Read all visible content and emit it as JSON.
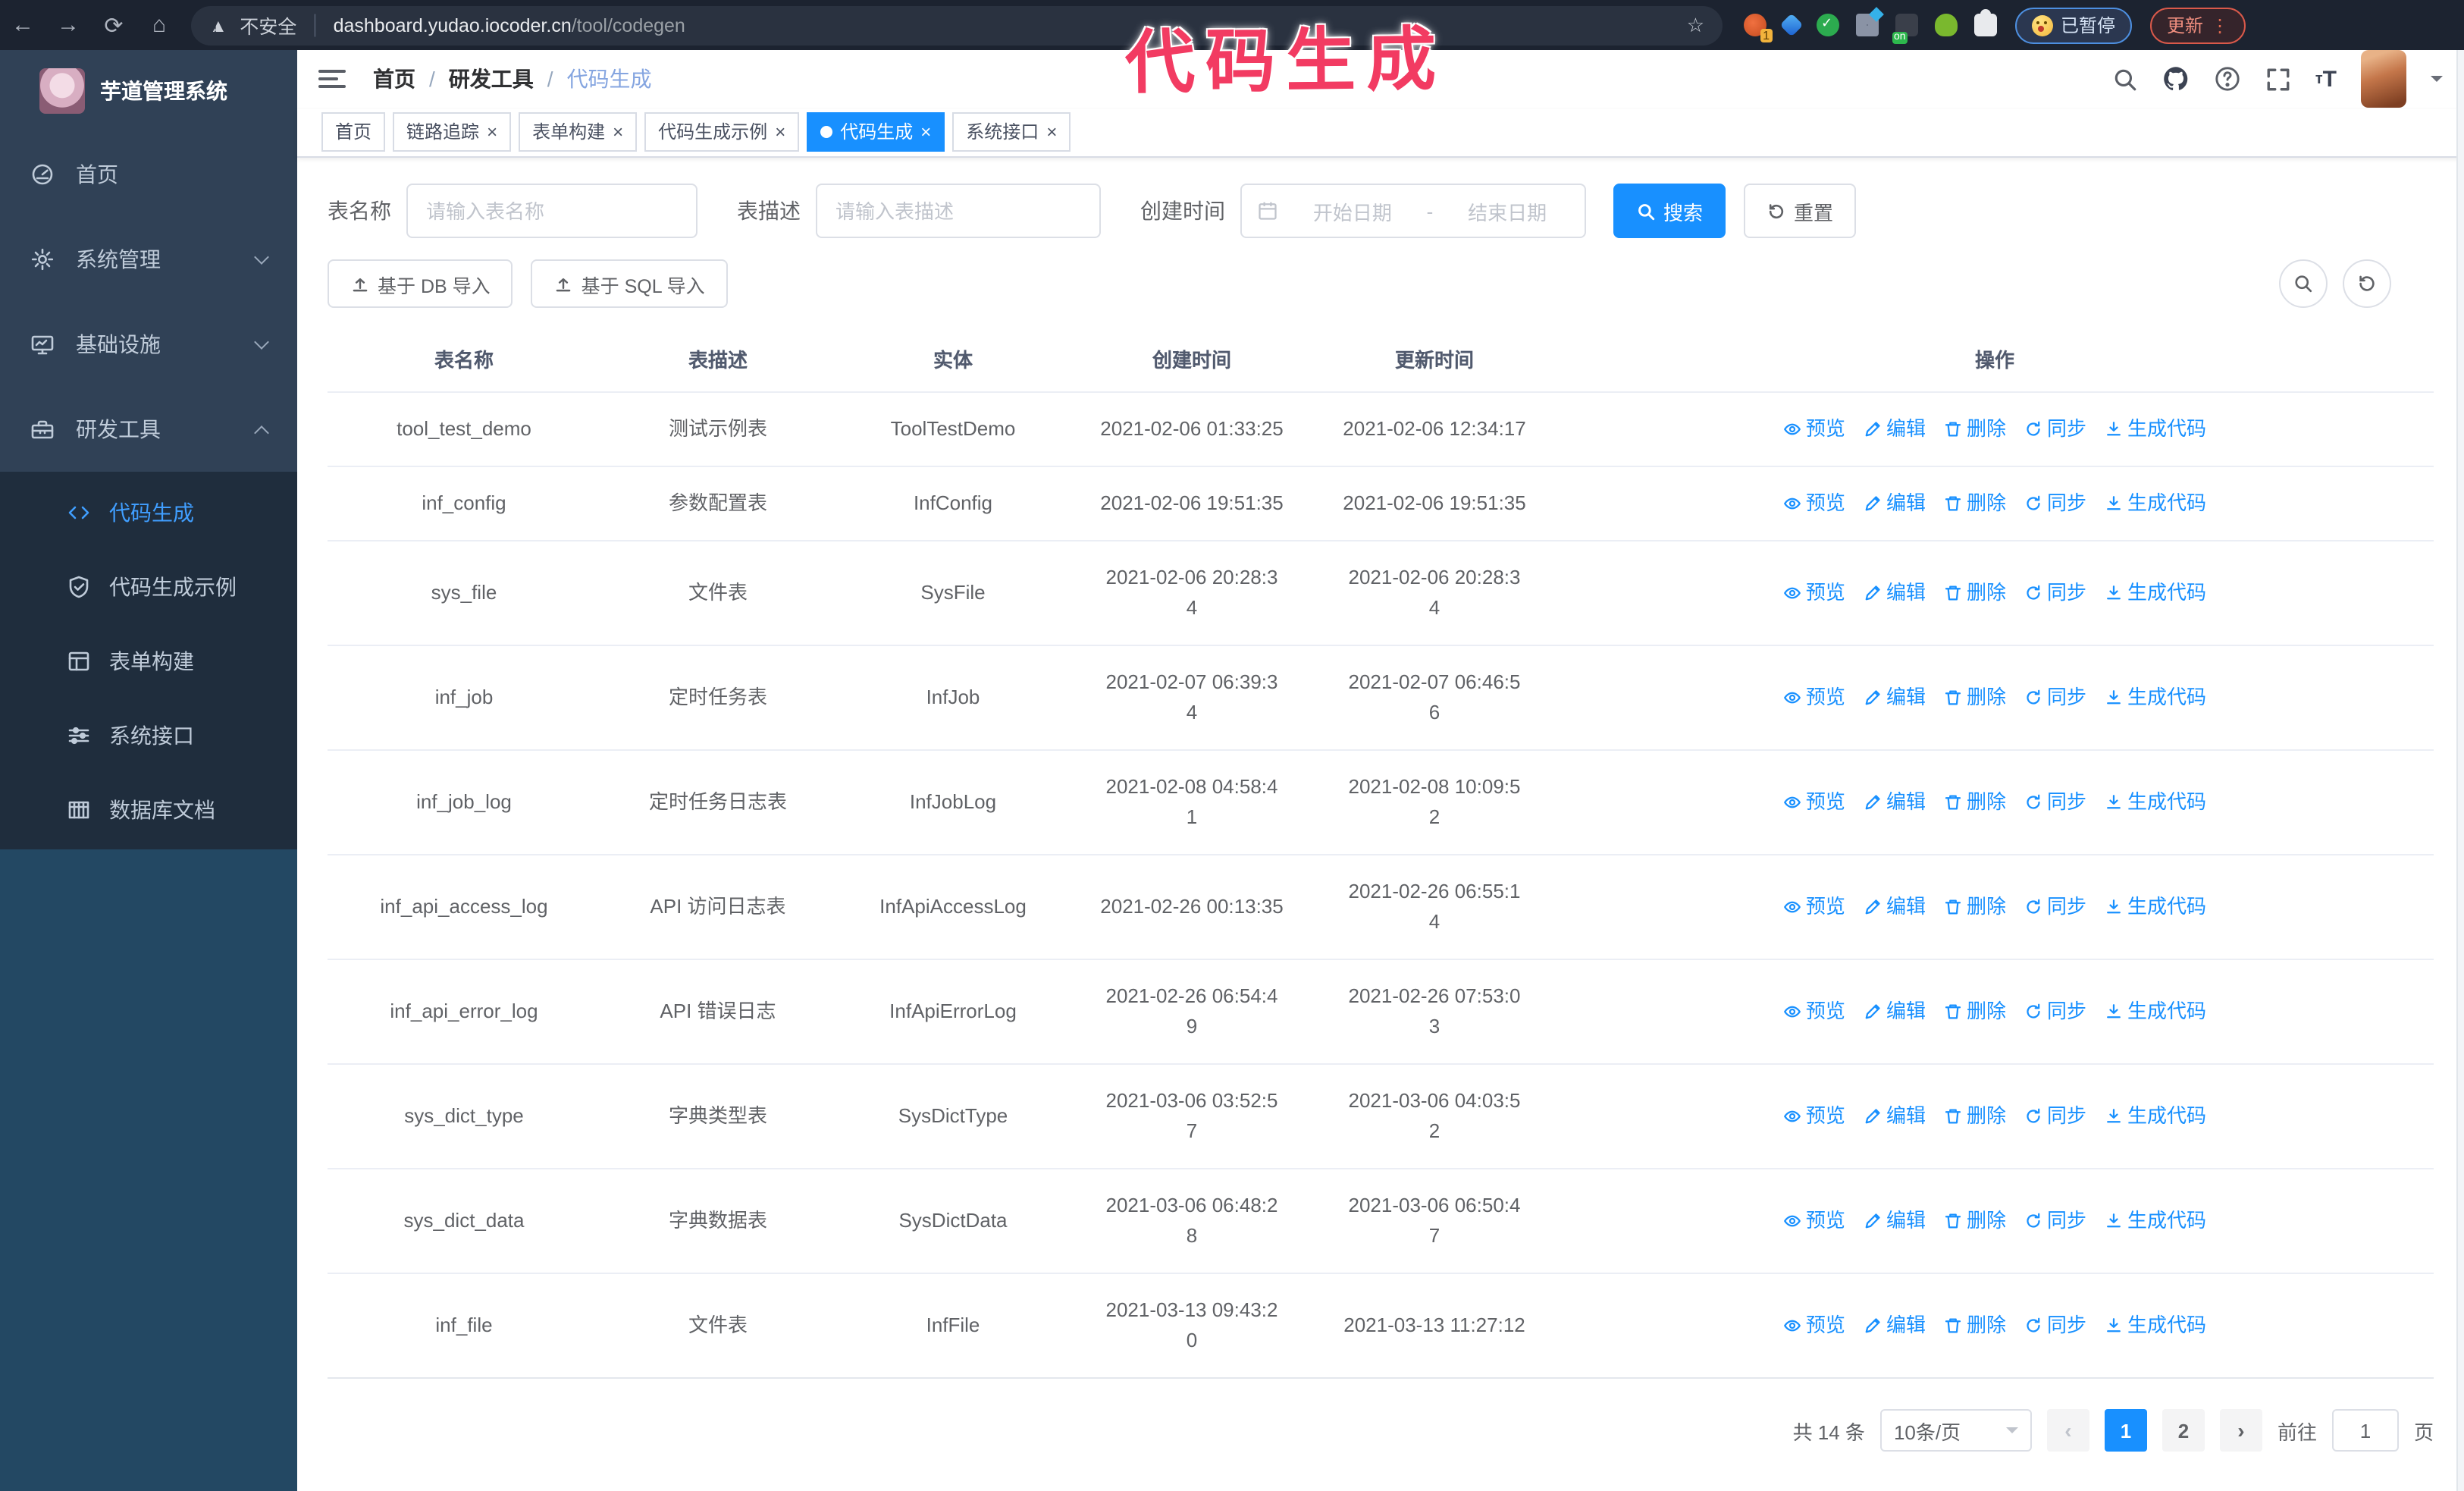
{
  "browser": {
    "security": "不安全",
    "url_host": "dashboard.yudao.iocoder.cn",
    "url_path": "/tool/codegen",
    "paused_label": "已暂停",
    "update_label": "更新"
  },
  "annotation": "代码生成",
  "colors": {
    "primary": "#1890ff",
    "sidebar_bg": "#304156",
    "submenu_bg": "#1f2d3d",
    "annotation": "#f23b62"
  },
  "sidebar": {
    "app_title": "芋道管理系统",
    "menu": [
      {
        "label": "首页",
        "icon": "dashboard-icon",
        "expandable": false,
        "state": "none"
      },
      {
        "label": "系统管理",
        "icon": "gear-icon",
        "expandable": true,
        "state": "collapsed"
      },
      {
        "label": "基础设施",
        "icon": "monitor-icon",
        "expandable": true,
        "state": "collapsed"
      },
      {
        "label": "研发工具",
        "icon": "toolbox-icon",
        "expandable": true,
        "state": "expanded"
      }
    ],
    "submenu": [
      {
        "label": "代码生成",
        "icon": "code-icon",
        "active": true
      },
      {
        "label": "代码生成示例",
        "icon": "shield-check-icon",
        "active": false
      },
      {
        "label": "表单构建",
        "icon": "form-icon",
        "active": false
      },
      {
        "label": "系统接口",
        "icon": "sliders-icon",
        "active": false
      },
      {
        "label": "数据库文档",
        "icon": "database-icon",
        "active": false
      }
    ]
  },
  "header": {
    "breadcrumb": [
      "首页",
      "研发工具",
      "代码生成"
    ]
  },
  "tabs": [
    {
      "label": "首页",
      "closable": false,
      "active": false
    },
    {
      "label": "链路追踪",
      "closable": true,
      "active": false
    },
    {
      "label": "表单构建",
      "closable": true,
      "active": false
    },
    {
      "label": "代码生成示例",
      "closable": true,
      "active": false
    },
    {
      "label": "代码生成",
      "closable": true,
      "active": true
    },
    {
      "label": "系统接口",
      "closable": true,
      "active": false
    }
  ],
  "filters": {
    "table_name_label": "表名称",
    "table_name_placeholder": "请输入表名称",
    "table_desc_label": "表描述",
    "table_desc_placeholder": "请输入表描述",
    "create_time_label": "创建时间",
    "date_start_placeholder": "开始日期",
    "date_separator": "-",
    "date_end_placeholder": "结束日期",
    "search_label": "搜索",
    "reset_label": "重置"
  },
  "toolbar": {
    "import_db_label": "基于 DB 导入",
    "import_sql_label": "基于 SQL 导入"
  },
  "table": {
    "columns": [
      "表名称",
      "表描述",
      "实体",
      "创建时间",
      "更新时间",
      "操作"
    ],
    "actions": [
      {
        "label": "预览",
        "icon": "eye-icon"
      },
      {
        "label": "编辑",
        "icon": "pencil-icon"
      },
      {
        "label": "删除",
        "icon": "trash-icon"
      },
      {
        "label": "同步",
        "icon": "sync-icon"
      },
      {
        "label": "生成代码",
        "icon": "download-icon"
      }
    ],
    "rows": [
      {
        "name": "tool_test_demo",
        "desc": "测试示例表",
        "entity": "ToolTestDemo",
        "created": [
          "2021-02-06 01:33:25"
        ],
        "updated": [
          "2021-02-06 12:34:17"
        ]
      },
      {
        "name": "inf_config",
        "desc": "参数配置表",
        "entity": "InfConfig",
        "created": [
          "2021-02-06 19:51:35"
        ],
        "updated": [
          "2021-02-06 19:51:35"
        ]
      },
      {
        "name": "sys_file",
        "desc": "文件表",
        "entity": "SysFile",
        "created": [
          "2021-02-06 20:28:3",
          "4"
        ],
        "updated": [
          "2021-02-06 20:28:3",
          "4"
        ]
      },
      {
        "name": "inf_job",
        "desc": "定时任务表",
        "entity": "InfJob",
        "created": [
          "2021-02-07 06:39:3",
          "4"
        ],
        "updated": [
          "2021-02-07 06:46:5",
          "6"
        ]
      },
      {
        "name": "inf_job_log",
        "desc": "定时任务日志表",
        "entity": "InfJobLog",
        "created": [
          "2021-02-08 04:58:4",
          "1"
        ],
        "updated": [
          "2021-02-08 10:09:5",
          "2"
        ]
      },
      {
        "name": "inf_api_access_log",
        "desc": "API 访问日志表",
        "entity": "InfApiAccessLog",
        "created": [
          "2021-02-26 00:13:35"
        ],
        "updated": [
          "2021-02-26 06:55:1",
          "4"
        ]
      },
      {
        "name": "inf_api_error_log",
        "desc": "API 错误日志",
        "entity": "InfApiErrorLog",
        "created": [
          "2021-02-26 06:54:4",
          "9"
        ],
        "updated": [
          "2021-02-26 07:53:0",
          "3"
        ]
      },
      {
        "name": "sys_dict_type",
        "desc": "字典类型表",
        "entity": "SysDictType",
        "created": [
          "2021-03-06 03:52:5",
          "7"
        ],
        "updated": [
          "2021-03-06 04:03:5",
          "2"
        ]
      },
      {
        "name": "sys_dict_data",
        "desc": "字典数据表",
        "entity": "SysDictData",
        "created": [
          "2021-03-06 06:48:2",
          "8"
        ],
        "updated": [
          "2021-03-06 06:50:4",
          "7"
        ]
      },
      {
        "name": "inf_file",
        "desc": "文件表",
        "entity": "InfFile",
        "created": [
          "2021-03-13 09:43:2",
          "0"
        ],
        "updated": [
          "2021-03-13 11:27:12"
        ]
      }
    ]
  },
  "pagination": {
    "total": "共 14 条",
    "page_size": "10条/页",
    "pages": [
      "1",
      "2"
    ],
    "current": "1",
    "goto_label": "前往",
    "goto_value": "1",
    "unit": "页"
  }
}
